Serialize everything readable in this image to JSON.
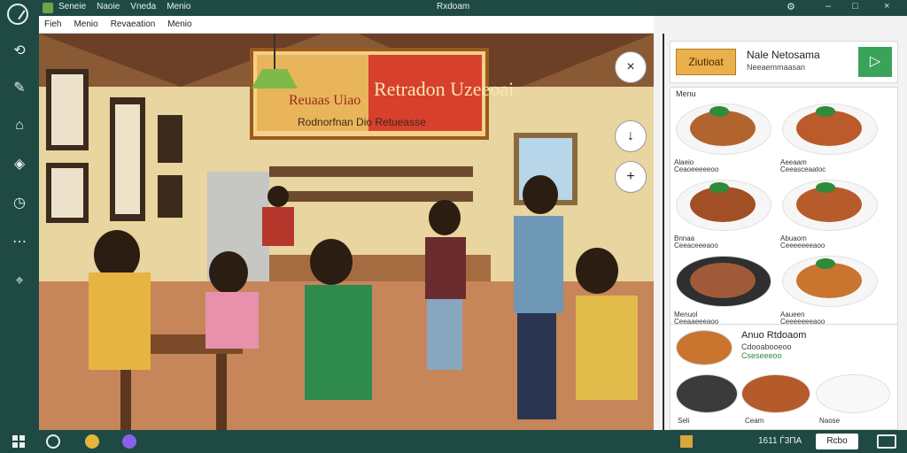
{
  "titlebar": {
    "menu": [
      "Seneie",
      "Naoie",
      "Vneda",
      "Menio"
    ],
    "title": "Rxdoam",
    "buttons": {
      "help": "⚙",
      "minimize": "–",
      "maximize": "□",
      "close": "×"
    }
  },
  "menubar": {
    "items": [
      "Fieh",
      "Menio",
      "Revaeation",
      "Menio"
    ]
  },
  "left_rail": {
    "items": [
      {
        "icon": "logo-icon",
        "glyph": "✓"
      },
      {
        "icon": "grid-icon",
        "glyph": "⟲"
      },
      {
        "icon": "tool-icon",
        "glyph": "✎"
      },
      {
        "icon": "cart-icon",
        "glyph": "⌂"
      },
      {
        "icon": "tag-icon",
        "glyph": "◈"
      },
      {
        "icon": "clock-icon",
        "glyph": "◷"
      },
      {
        "icon": "analytics-icon",
        "glyph": "⋯"
      },
      {
        "icon": "map-icon",
        "glyph": "⌖"
      }
    ]
  },
  "scene": {
    "banner_title": "Retradon Uzeeoai",
    "banner_sub": "Rodnorfnan Dio Retueasse",
    "board_left": "Reuaas Uiao",
    "zoom": {
      "rotate": "×",
      "down": "↓",
      "plus": "+"
    }
  },
  "right_panel": {
    "top_card": {
      "brand": "Ziutioat",
      "name": "Nale Netosama",
      "sub": "Neeaemmaasan",
      "go": "▷"
    },
    "menu_label": "Menu",
    "dishes": [
      {
        "cap": "Alaeio",
        "cap2": "Ceaoeeeeeoo",
        "food": "#b2642f"
      },
      {
        "cap": "Aeeaam",
        "cap2": "Ceeasceaatoc",
        "food": "#bb5a2a"
      },
      {
        "cap": "Bnnaa",
        "cap2": "Ceeaceeeaoo",
        "food": "#a24f25"
      },
      {
        "cap": "Abuaom",
        "cap2": "Ceeeeeeeaoo",
        "food": "#b85b2c"
      },
      {
        "cap": "Menuol",
        "cap2": "Ceeaaeeeaoo",
        "food": "#a05a3a"
      },
      {
        "cap": "Aaueen",
        "cap2": "Ceeeeeeeaoo",
        "food": "#c9742f"
      }
    ],
    "bottom_card": {
      "title": "Anuo Rtdoaom",
      "sub": "Cdooabooeoo",
      "tag": "Cseseeeoo"
    },
    "bottom_caps": [
      "Seli",
      "Ceam",
      "Naose"
    ]
  },
  "taskbar": {
    "status": "1611 Ѓ3ПА",
    "button": "Rcbo"
  }
}
